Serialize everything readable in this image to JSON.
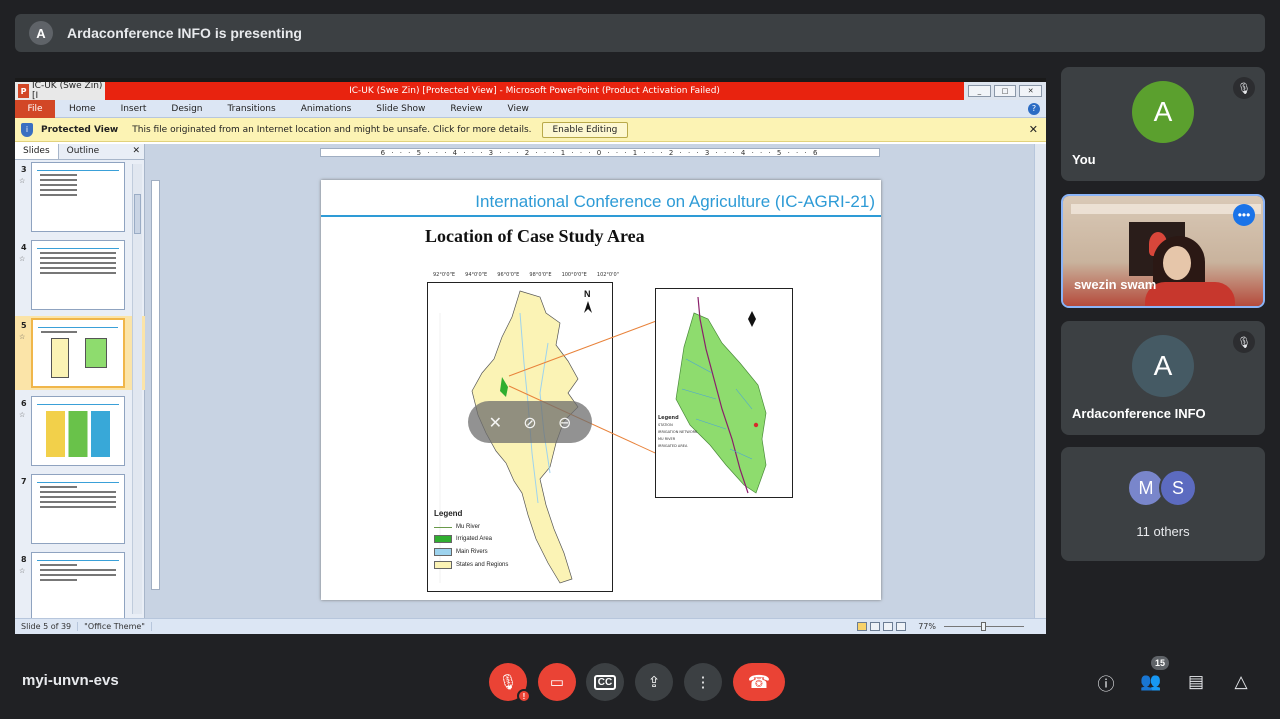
{
  "banner": {
    "avatar_letter": "A",
    "text": "Ardaconference INFO is presenting"
  },
  "powerpoint": {
    "title_left": "IC-UK (Swe Zin) [I",
    "title_center": "IC-UK (Swe Zin) [Protected View] - Microsoft PowerPoint (Product Activation Failed)",
    "ribbon_tabs": [
      "File",
      "Home",
      "Insert",
      "Design",
      "Transitions",
      "Animations",
      "Slide Show",
      "Review",
      "View"
    ],
    "protected_label": "Protected View",
    "protected_message": "This file originated from an Internet location and might be unsafe. Click for more details.",
    "enable_editing": "Enable Editing",
    "pane_tabs": [
      "Slides",
      "Outline"
    ],
    "thumbnail_numbers": [
      "3",
      "4",
      "5",
      "6",
      "7",
      "8"
    ],
    "selected_slide": "5",
    "status_slide": "Slide 5 of 39",
    "status_theme": "\"Office Theme\"",
    "zoom": "77%",
    "ruler_text": "6 · · · 5 · · · 4 · · · 3 · · · 2 · · · 1 · · · 0 · · · 1 · · · 2 · · · 3 · · · 4 · · · 5 · · · 6"
  },
  "slide": {
    "conference_title": "International Conference on Agriculture (IC-AGRI-21)",
    "heading": "Location of Case Study Area",
    "lon_labels": [
      "92°0'0\"E",
      "94°0'0\"E",
      "96°0'0\"E",
      "98°0'0\"E",
      "100°0'0\"E",
      "102°0'0\""
    ],
    "north_label": "N",
    "legend": {
      "title": "Legend",
      "items": [
        {
          "label": "Mu River",
          "color": "#6a9a4a"
        },
        {
          "label": "Irrigated Area",
          "color": "#2fae2f"
        },
        {
          "label": "Main Rivers",
          "color": "#9dd3ee"
        },
        {
          "label": "States and Regions",
          "color": "#fbf3b5"
        }
      ]
    },
    "inset_legend": {
      "title": "Legend",
      "items": [
        "STATION",
        "IRRIGATION NETWORK",
        "MU RIVER",
        "IRRIGATED AREA"
      ]
    }
  },
  "participants": [
    {
      "name": "You",
      "letter": "A",
      "color": "#5ba02e",
      "muted": true
    },
    {
      "name": "swezin swam",
      "video": true
    },
    {
      "name": "Ardaconference INFO",
      "letter": "A",
      "color": "#455a64",
      "muted": true
    },
    {
      "name": "11 others",
      "letters": [
        "M",
        "S"
      ]
    }
  ],
  "bottom": {
    "meeting_code": "myi-unvn-evs",
    "people_count": "15"
  }
}
